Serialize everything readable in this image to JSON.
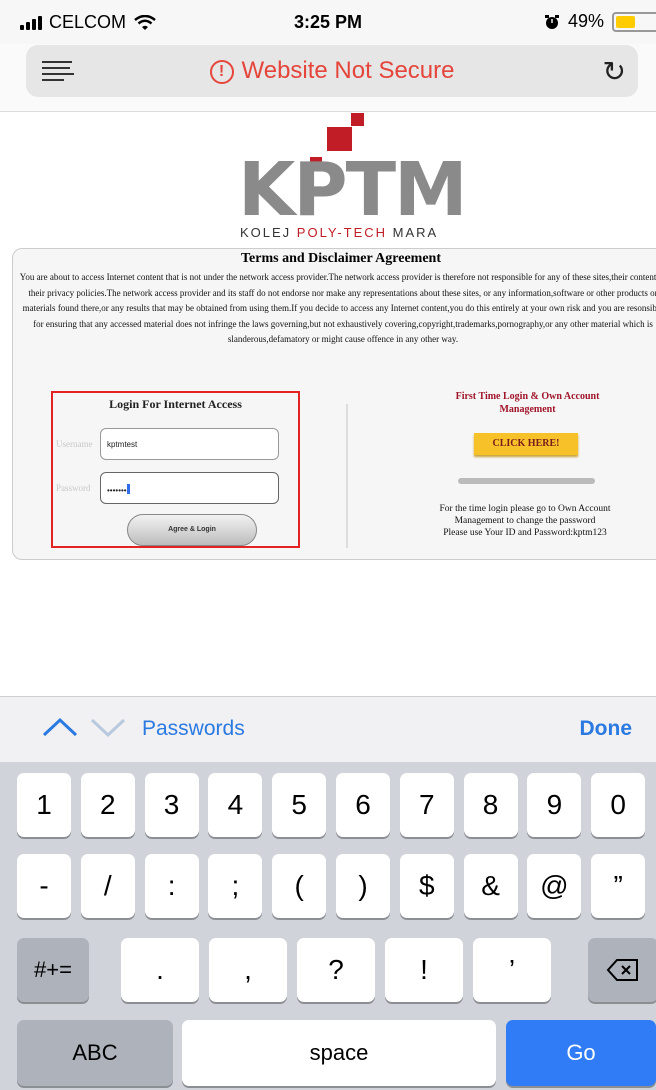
{
  "status_bar": {
    "carrier": "CELCOM",
    "time": "3:25 PM",
    "battery": "49%",
    "battery_level": 0.49
  },
  "url_bar": {
    "text": "Website Not Secure",
    "warning_glyph": "!",
    "reload_glyph": "↻"
  },
  "logo": {
    "text": "KPTM",
    "sub_left": "KOLEJ ",
    "sub_red": "POLY-TECH",
    "sub_right": " MARA"
  },
  "terms": {
    "title": "Terms and Disclaimer Agreement",
    "body": "You are about to access Internet content that is not under the network access provider.The network access provider is therefore not responsible for any of these sites,their content or their privacy policies.The network access provider and its staff do not endorse nor make any representations about these sites, or any information,software or other products or materials found there,or any results that may be obtained from using them.If you decide to access any Internet content,you do this entirely at your own risk and you are resonsible for ensuring that any accessed material does not infringe the laws governing,but not exhaustively covering,copyright,trademarks,pornography,or any other material which is slanderous,defamatory or might cause offence in any other way."
  },
  "login": {
    "title": "Login For Internet Access",
    "username_label": "Username",
    "username_value": "kptmtest",
    "password_label": "Password",
    "password_value": "•••••••",
    "button": "Agree & Login"
  },
  "first_time": {
    "title": "First Time Login & Own Account Management",
    "click_here": "CLICK HERE!",
    "note_line1": "For the time login please go to Own Account",
    "note_line2": "Management to change the password",
    "note_line3": "Please use Your ID and Password:kptm123"
  },
  "keyboard": {
    "toolbar_label": "Passwords",
    "done": "Done",
    "row1": [
      "1",
      "2",
      "3",
      "4",
      "5",
      "6",
      "7",
      "8",
      "9",
      "0"
    ],
    "row2": [
      "-",
      "/",
      ":",
      ";",
      "(",
      ")",
      "$",
      "&",
      "@",
      "”"
    ],
    "row3_left": "#+=",
    "row3": [
      ".",
      ",",
      "?",
      "!",
      "’"
    ],
    "abc": "ABC",
    "space": "space",
    "go": "Go"
  }
}
